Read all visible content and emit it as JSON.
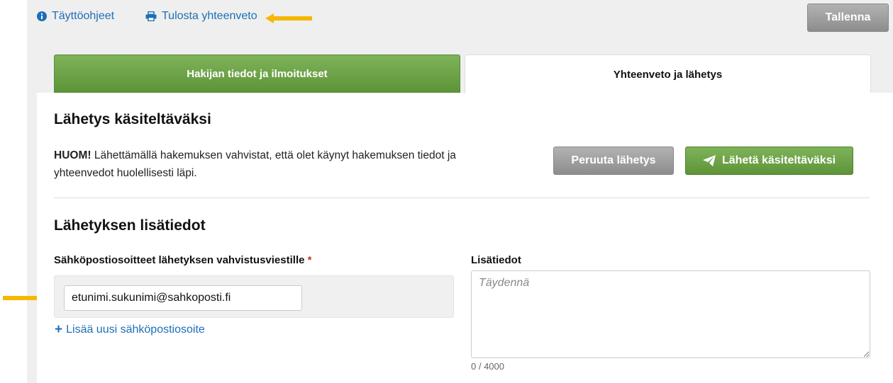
{
  "toolbar": {
    "help_label": "Täyttöohjeet",
    "print_label": "Tulosta yhteenveto",
    "save_label": "Tallenna"
  },
  "tabs": [
    {
      "label": "Hakijan tiedot ja ilmoitukset",
      "active": false
    },
    {
      "label": "Yhteenveto ja lähetys",
      "active": true
    }
  ],
  "send_section": {
    "title": "Lähetys käsiteltäväksi",
    "notice_bold": "HUOM!",
    "notice_text": " Lähettämällä hakemuksen vahvistat, että olet käynyt hakemuksen tiedot ja yhteenvedot huolellisesti läpi.",
    "cancel_label": "Peruuta lähetys",
    "submit_label": "Lähetä käsiteltäväksi"
  },
  "extra_section": {
    "title": "Lähetyksen lisätiedot",
    "email_label": "Sähköpostiosoitteet lähetyksen vahvistusviestille",
    "required_mark": "*",
    "email_value": "etunimi.sukunimi@sahkoposti.fi",
    "add_email_label": "Lisää uusi sähköpostiosoite",
    "info_label": "Lisätiedot",
    "info_placeholder": "Täydennä",
    "counter": "0 / 4000"
  },
  "colors": {
    "link": "#1c6fb7",
    "green": "#6aa343",
    "gray_button": "#9d9d9d",
    "arrow": "#f5b800"
  }
}
